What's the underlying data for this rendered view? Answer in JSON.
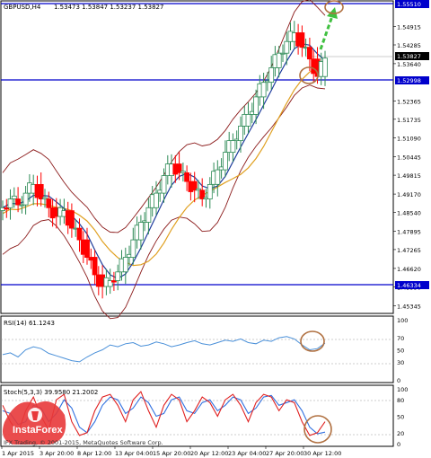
{
  "main_header": {
    "symbol": "GBPUSD,H4",
    "ohlc": "1.53473 1.53847 1.53237 1.53827"
  },
  "price_axis": [
    "1.55510",
    "1.54915",
    "1.54285",
    "1.53827",
    "1.53640",
    "1.52998",
    "1.52365",
    "1.51735",
    "1.51090",
    "1.50445",
    "1.49815",
    "1.49170",
    "1.48540",
    "1.47895",
    "1.47265",
    "1.46620",
    "1.46334",
    "1.45990",
    "1.45345"
  ],
  "highlight_levels": {
    "top": "1.55510",
    "current": "1.53827",
    "mid": "1.52998",
    "low": "1.46334"
  },
  "rsi": {
    "header": "RSI(14) 61.1243",
    "scale": [
      "100",
      "70",
      "50",
      "30",
      "0"
    ]
  },
  "stoch": {
    "header": "Stoch(5,3,3) 39.9580 21.2002",
    "scale": [
      "100",
      "80",
      "50",
      "20",
      "0"
    ]
  },
  "time_axis": [
    "1 Apr 2015",
    "3 Apr 20:00",
    "8 Apr 12:00",
    "13 Apr 04:00",
    "15 Apr 20:00",
    "20 Apr 12:00",
    "23 Apr 04:00",
    "27 Apr 20:00",
    "30 Apr 12:00"
  ],
  "watermark": {
    "brand": "InstaForex",
    "copyright": "IFX Trading, © 2001-2015, MetaQuotes Software Corp."
  },
  "colors": {
    "up_candle": "#2e8b57",
    "down_candle": "#ff0000",
    "level_line": "#0000cc",
    "bollinger": "#8b1a1a",
    "ma_fast": "#1e3c9c",
    "ma_slow": "#e0a020",
    "rsi_line": "#4a90d9",
    "stoch_main": "#e02020",
    "stoch_signal": "#3070e0",
    "annotation_circle": "#b07040",
    "arrow": "#40c040"
  },
  "chart_data": {
    "type": "candlestick",
    "symbol": "GBPUSD",
    "timeframe": "H4",
    "ylim": [
      1.452,
      1.557
    ],
    "close_path": [
      1.487,
      1.49,
      1.488,
      1.492,
      1.495,
      1.49,
      1.487,
      1.484,
      1.486,
      1.48,
      1.476,
      1.47,
      1.464,
      1.46,
      1.462,
      1.465,
      1.47,
      1.476,
      1.482,
      1.487,
      1.492,
      1.498,
      1.502,
      1.499,
      1.496,
      1.493,
      1.49,
      1.495,
      1.5,
      1.506,
      1.51,
      1.515,
      1.519,
      1.525,
      1.53,
      1.535,
      1.54,
      1.544,
      1.547,
      1.542,
      1.538,
      1.532,
      1.5383
    ],
    "rsi_value": 61.1243,
    "stoch_main": 39.958,
    "stoch_signal": 21.2002
  }
}
